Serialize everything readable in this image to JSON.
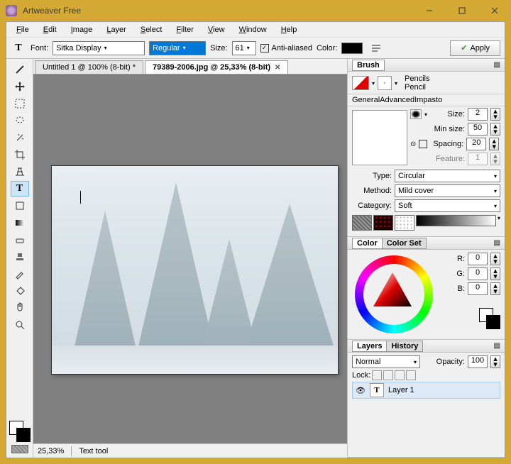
{
  "titlebar": {
    "title": "Artweaver Free"
  },
  "menu": {
    "file": "File",
    "edit": "Edit",
    "image": "Image",
    "layer": "Layer",
    "select": "Select",
    "filter": "Filter",
    "view": "View",
    "window": "Window",
    "help": "Help"
  },
  "fontbar": {
    "font_label": "Font:",
    "font_family": "Sitka Display",
    "font_style": "Regular",
    "size_label": "Size:",
    "size_value": "61",
    "aa_label": "Anti-aliased",
    "color_label": "Color:",
    "apply_label": "Apply"
  },
  "tabs": {
    "t1": "Untitled 1 @ 100% (8-bit) *",
    "t2": "79389-2006.jpg @ 25,33% (8-bit)"
  },
  "status": {
    "zoom": "25,33%",
    "tool": "Text tool"
  },
  "brush": {
    "title": "Brush",
    "family": "Pencils",
    "variant": "Pencil",
    "tab_general": "General",
    "tab_advanced": "Advanced",
    "tab_impasto": "Impasto",
    "size_label": "Size:",
    "size_val": "2",
    "minsize_label": "Min size:",
    "minsize_val": "50",
    "spacing_label": "Spacing:",
    "spacing_val": "20",
    "feature_label": "Feature:",
    "feature_val": "1",
    "type_label": "Type:",
    "type_val": "Circular",
    "method_label": "Method:",
    "method_val": "Mild cover",
    "category_label": "Category:",
    "category_val": "Soft"
  },
  "color": {
    "title": "Color",
    "tab2": "Color Set",
    "r_label": "R:",
    "r_val": "0",
    "g_label": "G:",
    "g_val": "0",
    "b_label": "B:",
    "b_val": "0"
  },
  "layers": {
    "title": "Layers",
    "tab2": "History",
    "blend": "Normal",
    "opacity_label": "Opacity:",
    "opacity_val": "100",
    "lock_label": "Lock:",
    "layer1": "Layer 1"
  }
}
